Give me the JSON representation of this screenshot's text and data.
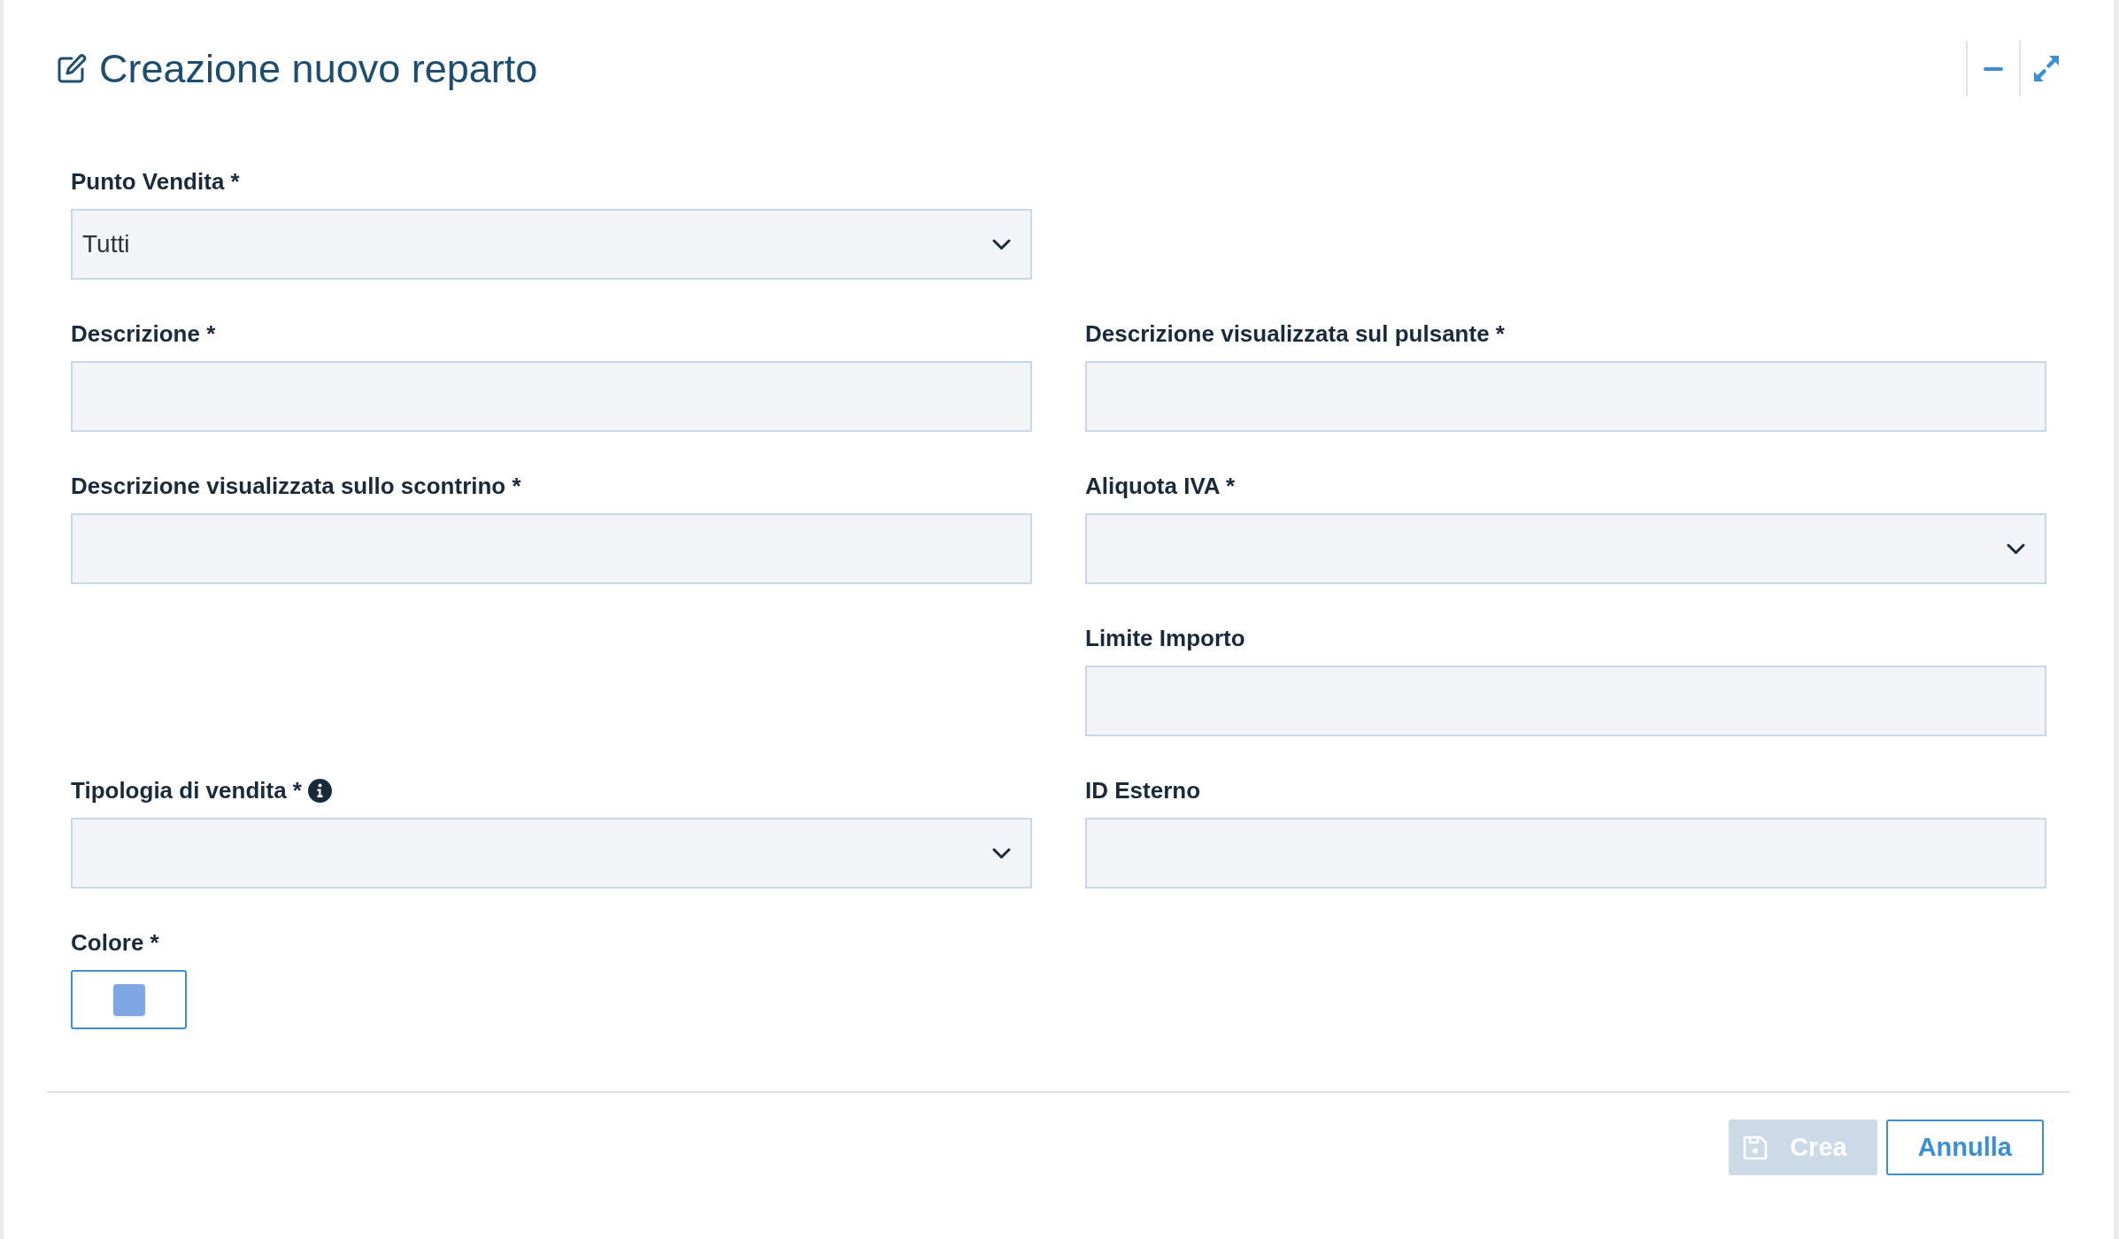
{
  "dialog": {
    "title": "Creazione nuovo reparto",
    "form": {
      "rows": [
        {
          "left": {
            "label": "Punto Vendita *",
            "kind": "select",
            "value": "Tutti",
            "info_icon": false
          }
        },
        {
          "left": {
            "label": "Descrizione *",
            "kind": "text",
            "info_icon": false
          },
          "right": {
            "label": "Descrizione visualizzata sul pulsante *",
            "kind": "text",
            "info_icon": false
          }
        },
        {
          "left": {
            "label": "Descrizione visualizzata sullo scontrino *",
            "kind": "text",
            "info_icon": false
          },
          "right": {
            "label": "Aliquota IVA *",
            "kind": "select",
            "info_icon": false
          }
        },
        {
          "right": {
            "label": "Limite Importo",
            "kind": "text",
            "info_icon": false
          }
        },
        {
          "left": {
            "label": "Tipologia di vendita *",
            "kind": "select",
            "info_icon": true
          },
          "right": {
            "label": "ID Esterno",
            "kind": "text",
            "info_icon": false
          }
        },
        {
          "left": {
            "label": "Colore *",
            "kind": "color",
            "color": "#7ea7e3",
            "info_icon": false
          }
        }
      ]
    },
    "buttons": [
      {
        "label": "Crea",
        "kind": "save",
        "disabled": true
      },
      {
        "label": "Annulla",
        "kind": "cancel",
        "disabled": false
      }
    ]
  }
}
